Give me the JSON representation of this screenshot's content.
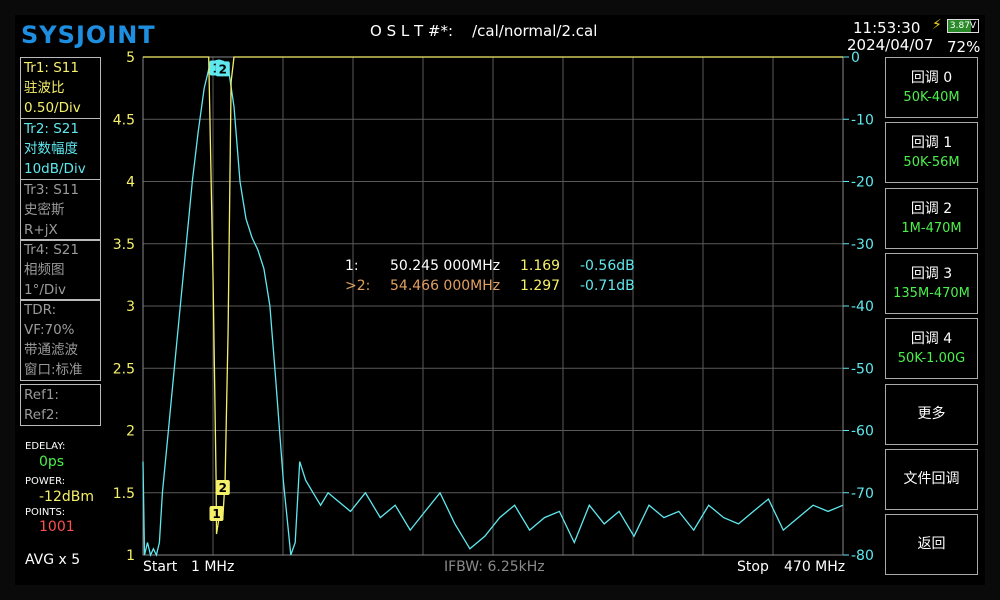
{
  "header": {
    "logo": "SYSJOINT",
    "title": "O S L T #*:    /cal/normal/2.cal",
    "time": "11:53:30",
    "battery_voltage": "3.87V",
    "date": "2024/04/07",
    "battery_percent": "72%"
  },
  "traces": [
    {
      "line1": "Tr1:   S11",
      "line2": "驻波比",
      "line3": "0.50/Div"
    },
    {
      "line1": "Tr2:   S21",
      "line2": "对数幅度",
      "line3": "10dB/Div"
    },
    {
      "line1": "Tr3:   S11",
      "line2": "史密斯",
      "line3": "R+jX"
    },
    {
      "line1": "Tr4:   S21",
      "line2": "相频图",
      "line3": "1°/Div"
    }
  ],
  "tdr": {
    "line1": "TDR:",
    "line2": "VF:70%",
    "line3": "带通滤波",
    "line4": "窗口:标准"
  },
  "refs": {
    "ref1": "Ref1:",
    "ref2": "Ref2:"
  },
  "status": {
    "edelay_label": "EDELAY:",
    "edelay_value": "0ps",
    "power_label": "POWER:",
    "power_value": "-12dBm",
    "points_label": "POINTS:",
    "points_value": "1001",
    "avg": "AVG x 5"
  },
  "softkeys": [
    {
      "label": "回调 0",
      "sub": "50K-40M"
    },
    {
      "label": "回调 1",
      "sub": "50K-56M"
    },
    {
      "label": "回调 2",
      "sub": "1M-470M"
    },
    {
      "label": "回调 3",
      "sub": "135M-470M"
    },
    {
      "label": "回调 4",
      "sub": "50K-1.00G"
    },
    {
      "label": "更多"
    },
    {
      "label": "文件回调"
    },
    {
      "label": "返回"
    }
  ],
  "footer": {
    "start_label": "Start",
    "start_value": "1 MHz",
    "ifbw": "IFBW: 6.25kHz",
    "stop_label": "Stop",
    "stop_value": "470 MHz"
  },
  "markers": [
    {
      "id": "1:",
      "freq": "50.245 000MHz",
      "vswr": "1.169",
      "mag": "-0.56dB"
    },
    {
      "id": ">2:",
      "freq": "54.466 000MHz",
      "vswr": "1.297",
      "mag": "-0.71dB"
    }
  ],
  "colors": {
    "trace1": "#f5f06a",
    "trace2": "#5fe8ee",
    "active_marker": "#e0a060",
    "grid": "#5a5a5a",
    "softkey_value": "#4cf04c"
  },
  "chart_data": {
    "type": "line",
    "x_start_mhz": 1,
    "x_stop_mhz": 470,
    "grid": true,
    "left_axis": {
      "ticks": [
        "5",
        "4.5",
        "4",
        "3.5",
        "3",
        "2.5",
        "2",
        "1.5",
        "1"
      ],
      "ylim": [
        1,
        5
      ]
    },
    "right_axis": {
      "ticks": [
        "0",
        "-10",
        "-20",
        "-30",
        "-40",
        "-50",
        "-60",
        "-70",
        "-80"
      ],
      "ylim": [
        -80,
        0
      ]
    },
    "series": [
      {
        "name": "Tr1 S11",
        "x": [
          1,
          20,
          28,
          35,
          40,
          45,
          48,
          50,
          50.245,
          52,
          54.466,
          56,
          58,
          60,
          62,
          65,
          70,
          80,
          100,
          470
        ],
        "y": [
          5,
          5,
          5,
          5,
          5,
          5,
          3.2,
          1.6,
          1.169,
          1.3,
          1.297,
          1.6,
          2.8,
          4.8,
          5,
          5,
          5,
          5,
          5,
          5
        ]
      },
      {
        "name": "Tr2 S21",
        "x": [
          1,
          2,
          4,
          6,
          8,
          10,
          12,
          14,
          18,
          22,
          26,
          30,
          34,
          38,
          42,
          46,
          50,
          52,
          55,
          58,
          62,
          66,
          70,
          74,
          78,
          82,
          86,
          90,
          95,
          100,
          103,
          106,
          110,
          115,
          120,
          125,
          130,
          140,
          150,
          160,
          170,
          180,
          190,
          200,
          210,
          220,
          230,
          240,
          250,
          260,
          270,
          280,
          290,
          300,
          310,
          320,
          330,
          340,
          350,
          360,
          370,
          380,
          390,
          400,
          410,
          420,
          430,
          440,
          450,
          460,
          470
        ],
        "y": [
          -65,
          -80,
          -78,
          -80,
          -79,
          -80,
          -78,
          -70,
          -60,
          -50,
          -40,
          -30,
          -20,
          -12,
          -5,
          -1,
          -0.6,
          -0.5,
          -0.7,
          -1.5,
          -8,
          -20,
          -26,
          -29,
          -31,
          -34,
          -40,
          -52,
          -68,
          -80,
          -78,
          -65,
          -68,
          -70,
          -72,
          -70,
          -71,
          -73,
          -70,
          -74,
          -72,
          -76,
          -73,
          -70,
          -75,
          -79,
          -77,
          -74,
          -72,
          -76,
          -74,
          -73,
          -78,
          -72,
          -75,
          -73,
          -77,
          -72,
          -74,
          -73,
          -76,
          -72,
          -74,
          -75,
          -73,
          -71,
          -76,
          -74,
          -72,
          -73,
          -72
        ]
      }
    ]
  }
}
